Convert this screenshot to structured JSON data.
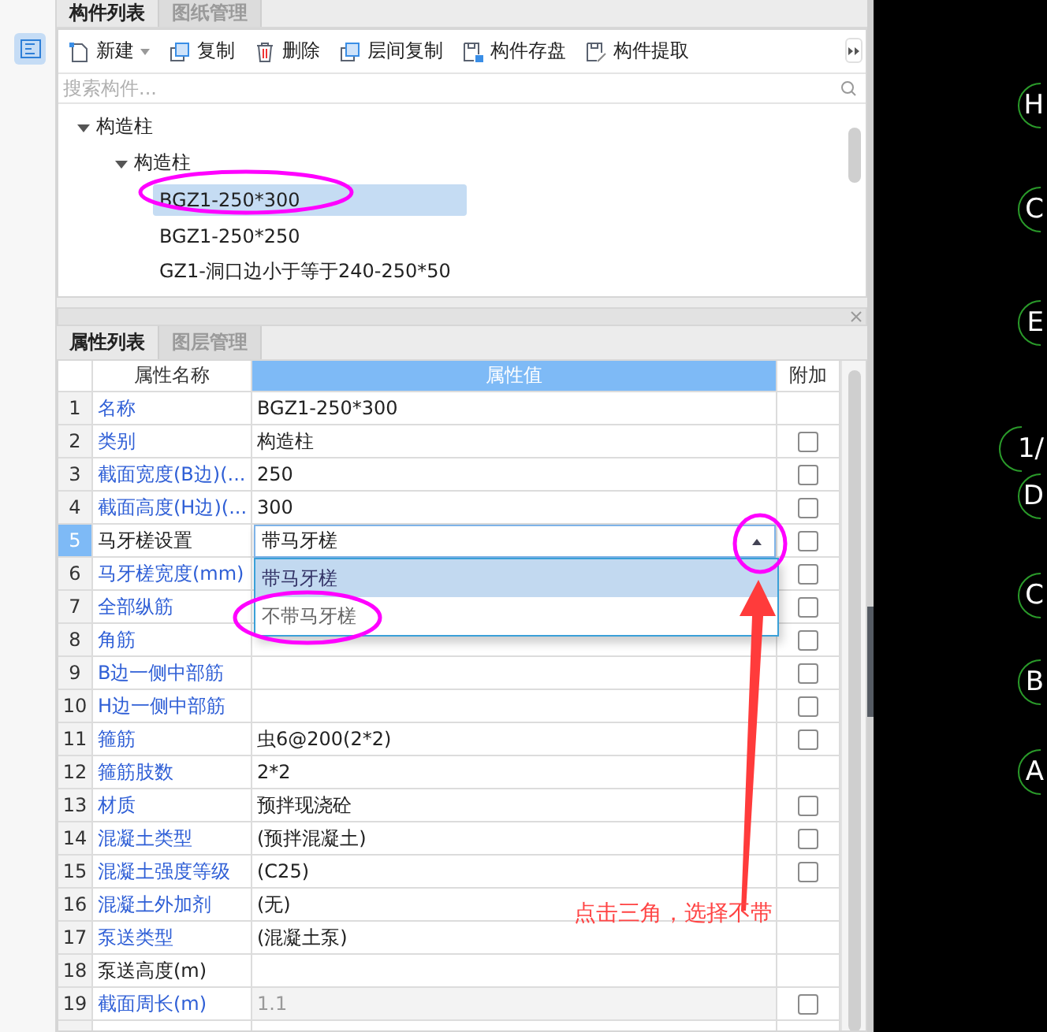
{
  "top_tabs": [
    {
      "label": "构件列表",
      "selected": true
    },
    {
      "label": "图纸管理",
      "selected": false
    }
  ],
  "toolbar": [
    {
      "label": "新建",
      "menu": true
    },
    {
      "label": "复制",
      "menu": false
    },
    {
      "label": "删除",
      "menu": false
    },
    {
      "label": "层间复制",
      "menu": false
    },
    {
      "label": "构件存盘",
      "menu": false
    },
    {
      "label": "构件提取",
      "menu": false
    }
  ],
  "search": {
    "placeholder": "搜索构件..."
  },
  "tree": [
    {
      "label": "构造柱",
      "expanded": true,
      "selected": false,
      "children": [
        {
          "label": "构造柱",
          "expanded": true,
          "selected": false,
          "children": [
            {
              "label": "BGZ1-250*300",
              "selected": true
            },
            {
              "label": "BGZ1-250*250",
              "selected": false
            },
            {
              "label": "GZ1-洞口边小于等于240-250*50",
              "selected": false
            }
          ]
        }
      ]
    }
  ],
  "bottom_tabs": [
    {
      "label": "属性列表",
      "selected": true
    },
    {
      "label": "图层管理",
      "selected": false
    }
  ],
  "table": {
    "columns": [
      "属性名称",
      "属性值",
      "附加"
    ],
    "rows": [
      {
        "num": "1",
        "name": "名称",
        "value": "BGZ1-250*300",
        "public": true,
        "selected": false,
        "value_disabled": false
      },
      {
        "num": "2",
        "name": "类别",
        "value": "构造柱",
        "public": true,
        "selected": false,
        "value_disabled": false,
        "checked": false
      },
      {
        "num": "3",
        "name": "截面宽度(B边)(...",
        "value": "250",
        "public": true,
        "selected": false,
        "value_disabled": false,
        "checked": false
      },
      {
        "num": "4",
        "name": "截面高度(H边)(...",
        "value": "300",
        "public": true,
        "selected": false,
        "value_disabled": false,
        "checked": false
      },
      {
        "num": "5",
        "name": "马牙槎设置",
        "value": "带马牙槎",
        "public": false,
        "selected": true,
        "value_disabled": false,
        "checked": false,
        "dropdown": {
          "expanded": true,
          "options": [
            {
              "label": "带马牙槎",
              "selected": true
            },
            {
              "label": "不带马牙槎",
              "selected": false
            }
          ]
        }
      },
      {
        "num": "6",
        "name": "马牙槎宽度(mm)",
        "value": "",
        "public": true,
        "selected": false,
        "value_disabled": false,
        "checked": false
      },
      {
        "num": "7",
        "name": "全部纵筋",
        "value": "",
        "public": true,
        "selected": false,
        "value_disabled": false,
        "checked": false
      },
      {
        "num": "8",
        "name": "角筋",
        "value": "",
        "public": true,
        "selected": false,
        "value_disabled": false,
        "checked": false
      },
      {
        "num": "9",
        "name": "B边一侧中部筋",
        "value": "",
        "public": true,
        "selected": false,
        "value_disabled": false,
        "checked": false
      },
      {
        "num": "10",
        "name": "H边一侧中部筋",
        "value": "",
        "public": true,
        "selected": false,
        "value_disabled": false,
        "checked": false
      },
      {
        "num": "11",
        "name": "箍筋",
        "value": "虫6@200(2*2)",
        "public": true,
        "selected": false,
        "value_disabled": false,
        "checked": false
      },
      {
        "num": "12",
        "name": "箍筋肢数",
        "value": "2*2",
        "public": true,
        "selected": false,
        "value_disabled": false
      },
      {
        "num": "13",
        "name": "材质",
        "value": "预拌现浇砼",
        "public": true,
        "selected": false,
        "value_disabled": false,
        "checked": false
      },
      {
        "num": "14",
        "name": "混凝土类型",
        "value": "(预拌混凝土)",
        "public": true,
        "selected": false,
        "value_disabled": false,
        "checked": false
      },
      {
        "num": "15",
        "name": "混凝土强度等级",
        "value": "(C25)",
        "public": true,
        "selected": false,
        "value_disabled": false,
        "checked": false
      },
      {
        "num": "16",
        "name": "混凝土外加剂",
        "value": "(无)",
        "public": true,
        "selected": false,
        "value_disabled": false
      },
      {
        "num": "17",
        "name": "泵送类型",
        "value": "(混凝土泵)",
        "public": true,
        "selected": false,
        "value_disabled": false
      },
      {
        "num": "18",
        "name": "泵送高度(m)",
        "value": "",
        "public": false,
        "selected": false,
        "value_disabled": false
      },
      {
        "num": "19",
        "name": "截面周长(m)",
        "value": "1.1",
        "public": true,
        "selected": false,
        "value_disabled": true,
        "checked": false
      }
    ]
  },
  "cad_labels": [
    "H",
    "C",
    "E",
    "1/",
    "D",
    "C",
    "B",
    "A"
  ],
  "annotation": {
    "text": "点击三角，选择不带"
  }
}
